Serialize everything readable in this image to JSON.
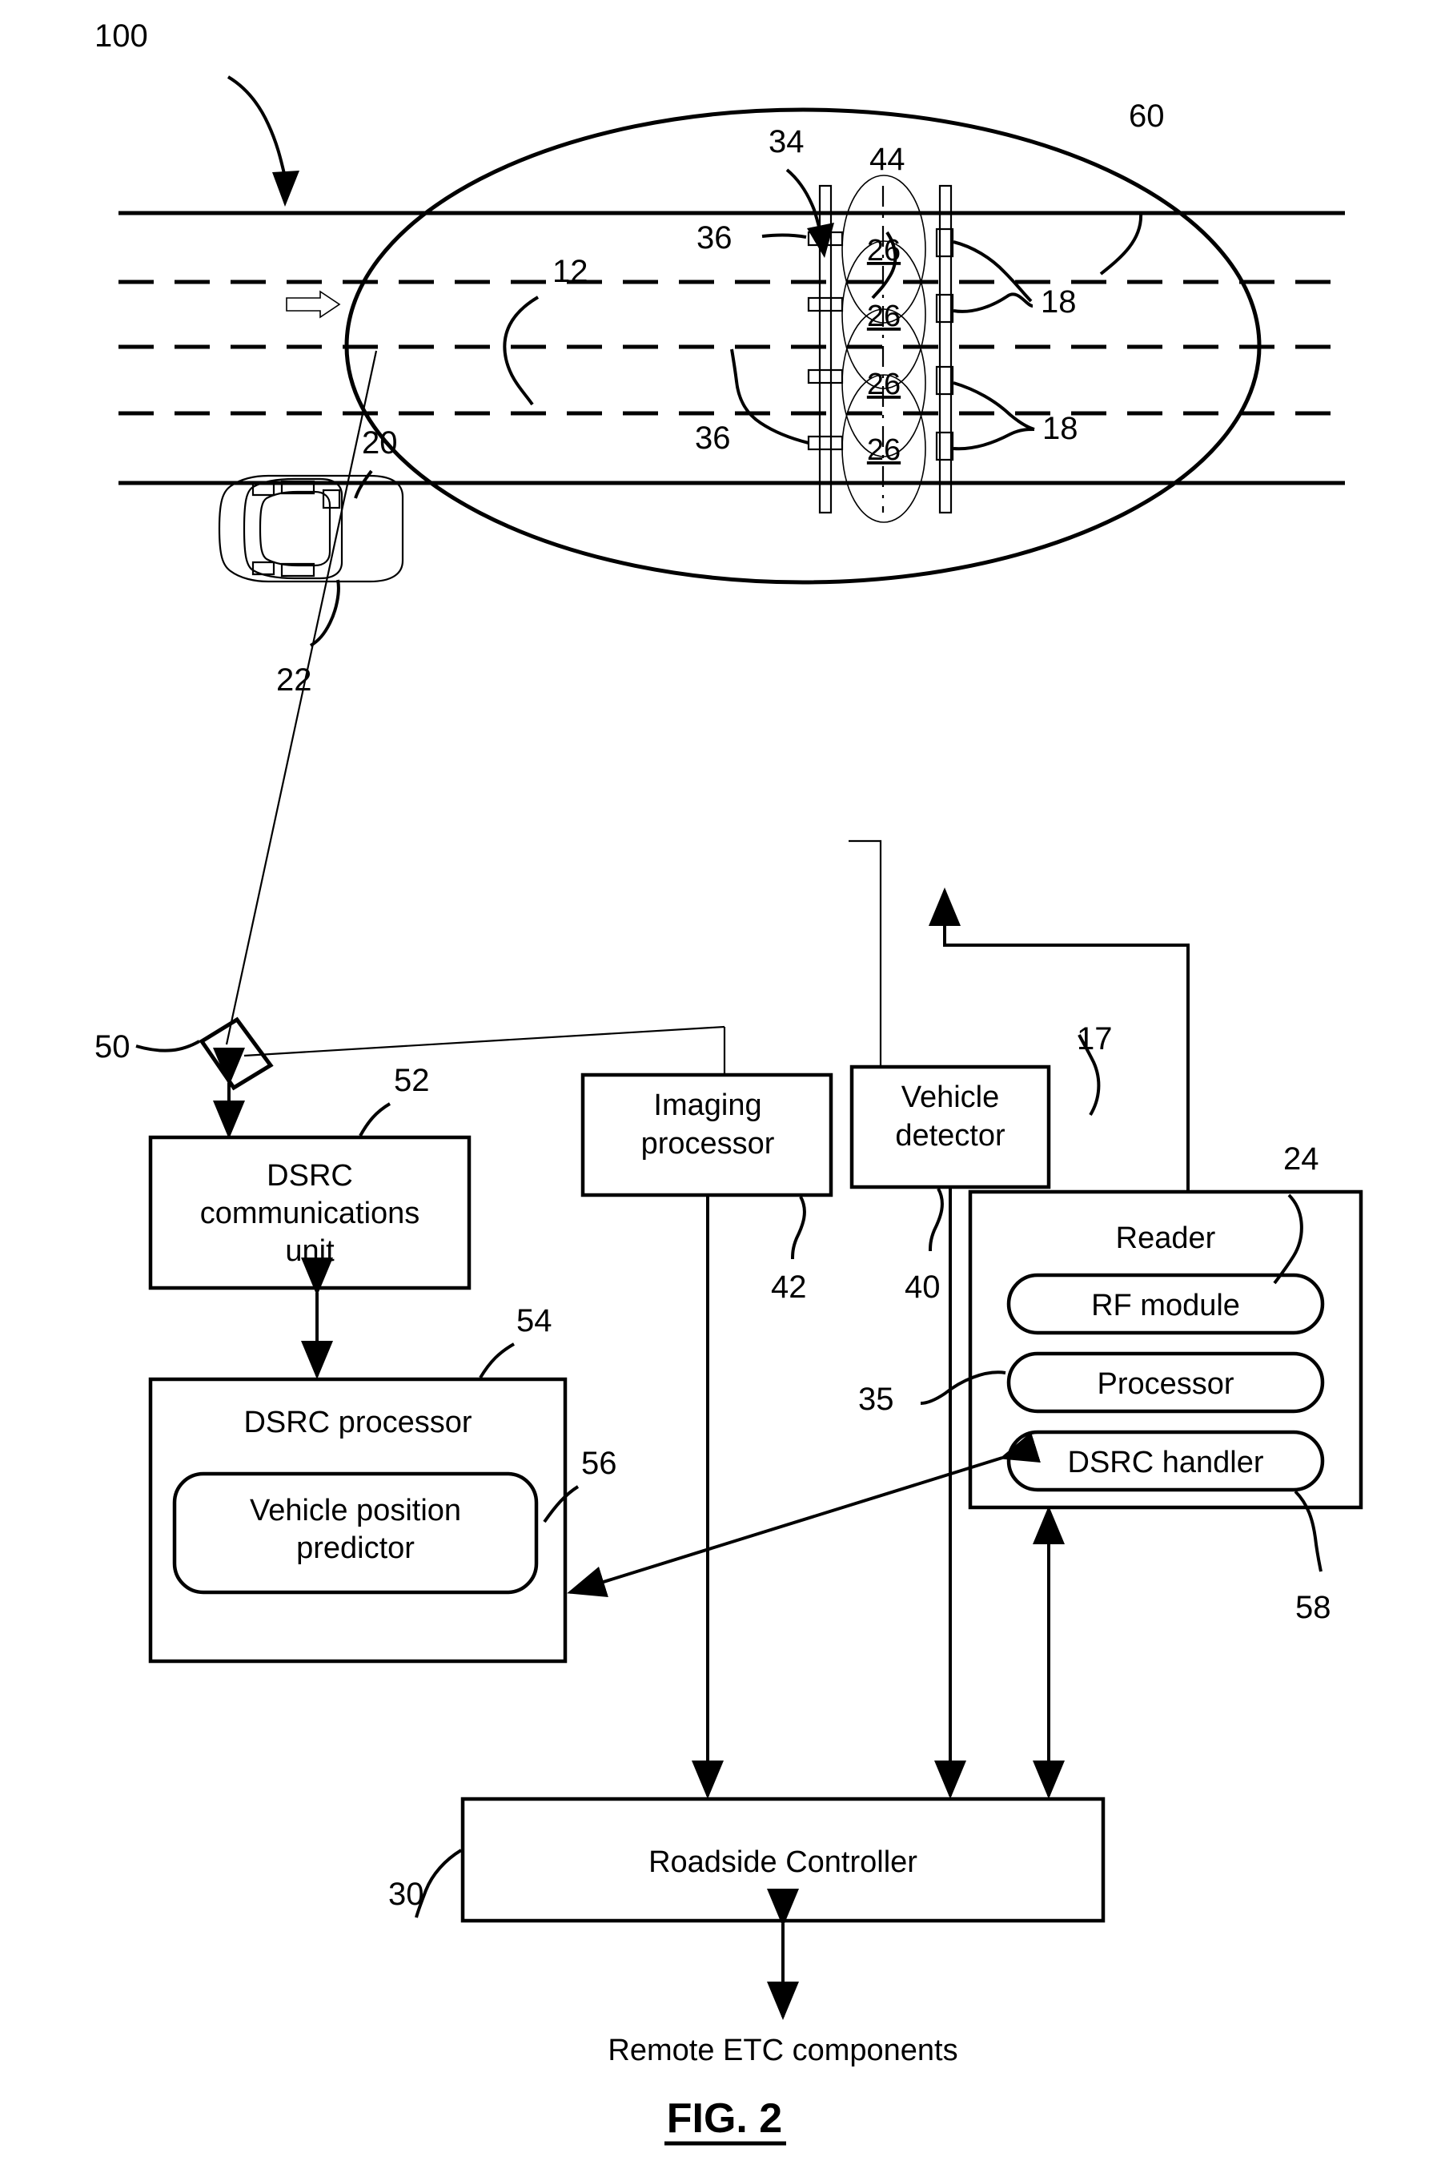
{
  "figure": {
    "caption": "FIG. 2",
    "system_ref": "100"
  },
  "scene": {
    "coverage_ellipse_ref": "60",
    "roadway_ref": "12",
    "vehicle_ref": "20",
    "transponder_ref": "22",
    "gantry_ref": "34",
    "boundary_line_ref": "44",
    "camera_ref": "50",
    "direction_arrow": "right",
    "antenna_labels": [
      "36",
      "36"
    ],
    "reader_antenna_labels": [
      "18",
      "18"
    ],
    "zone_labels": [
      "26",
      "26",
      "26",
      "26"
    ]
  },
  "blocks": {
    "dsrc_comm_unit": {
      "label": "DSRC communications unit",
      "ref": "52"
    },
    "dsrc_processor": {
      "label": "DSRC processor",
      "ref": "54"
    },
    "vehicle_position_predictor": {
      "label": "Vehicle position predictor",
      "ref": "56"
    },
    "imaging_processor": {
      "label": "Imaging processor",
      "ref": "42"
    },
    "vehicle_detector": {
      "label": "Vehicle detector",
      "ref": "40"
    },
    "reader": {
      "label": "Reader",
      "ref": "24",
      "link_ref": "17"
    },
    "rf_module": {
      "label": "RF module"
    },
    "processor": {
      "label": "Processor",
      "ref": "35"
    },
    "dsrc_handler": {
      "label": "DSRC handler",
      "ref": "58"
    },
    "roadside_controller": {
      "label": "Roadside Controller",
      "ref": "30"
    },
    "remote_etc": {
      "label": "Remote ETC components"
    }
  },
  "colors": {
    "ink": "#000000",
    "paper": "#ffffff"
  }
}
